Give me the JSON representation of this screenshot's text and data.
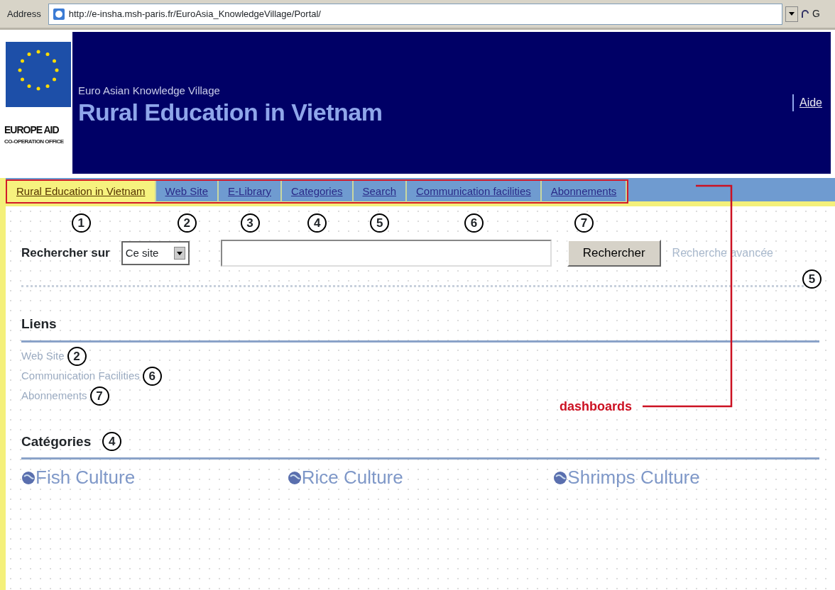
{
  "address_bar": {
    "label": "Address",
    "url": "http://e-insha.msh-paris.fr/EuroAsia_KnowledgeVillage/Portal/",
    "go": "G"
  },
  "header": {
    "logo_lines": [
      "EUROPE AID",
      "CO-OPERATION OFFICE"
    ],
    "subtitle": "Euro Asian Knowledge Village",
    "title": "Rural Education in Vietnam",
    "help_link": "Aide"
  },
  "tabs": [
    {
      "label": "Rural Education in Vietnam",
      "selected": true,
      "marker": "1"
    },
    {
      "label": "Web Site",
      "selected": false,
      "marker": "2"
    },
    {
      "label": "E-Library",
      "selected": false,
      "marker": "3"
    },
    {
      "label": "Categories",
      "selected": false,
      "marker": "4"
    },
    {
      "label": "Search",
      "selected": false,
      "marker": "5"
    },
    {
      "label": "Communication facilities",
      "selected": false,
      "marker": "6"
    },
    {
      "label": "Abonnements",
      "selected": false,
      "marker": "7"
    }
  ],
  "search": {
    "label": "Rechercher sur",
    "scope": "Ce site",
    "button": "Rechercher",
    "advanced_link": "Recherche avancée",
    "marker": "5"
  },
  "links_section": {
    "heading": "Liens",
    "items": [
      {
        "label": "Web Site",
        "marker": "2"
      },
      {
        "label": "Communication Facilities",
        "marker": "6"
      },
      {
        "label": "Abonnements",
        "marker": "7"
      }
    ]
  },
  "categories_section": {
    "heading": "Catégories",
    "marker": "4",
    "items": [
      "Fish Culture",
      "Rice Culture",
      "Shrimps Culture"
    ]
  },
  "annotation": {
    "label": "dashboards"
  }
}
